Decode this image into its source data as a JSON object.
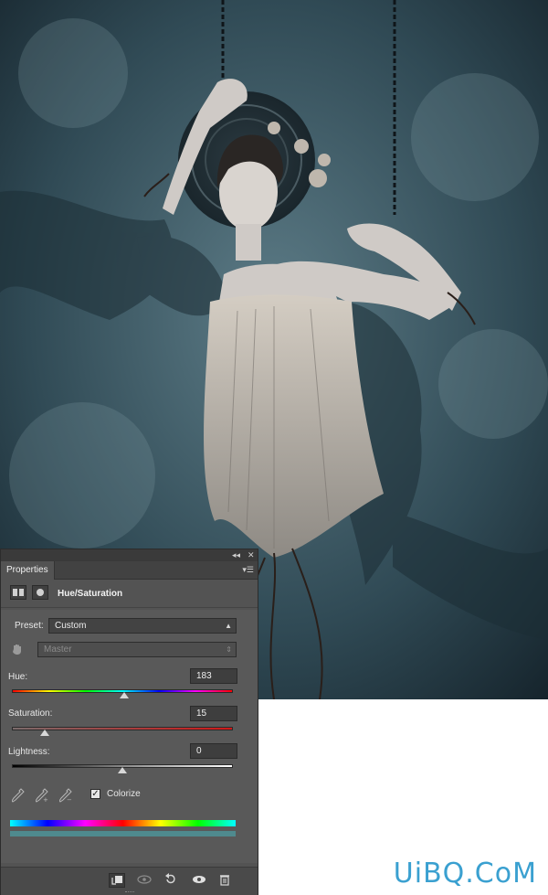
{
  "watermark": "UiBQ.CoM",
  "panel": {
    "tab_label": "Properties",
    "collapse_icon": "double-chevron-left-icon",
    "close_icon": "close-icon",
    "menu_icon": "panel-menu-icon",
    "adjustment_title": "Hue/Saturation",
    "preset": {
      "label": "Preset:",
      "value": "Custom"
    },
    "channel": {
      "value": "Master"
    },
    "hue": {
      "label": "Hue:",
      "value": "183",
      "slider_fraction": 0.508
    },
    "saturation": {
      "label": "Saturation:",
      "value": "15",
      "slider_fraction": 0.15
    },
    "lightness": {
      "label": "Lightness:",
      "value": "0",
      "slider_fraction": 0.5
    },
    "colorize": {
      "label": "Colorize",
      "checked": true,
      "mark": "✓"
    },
    "result_color": "#4f8a8e",
    "bottom_icons": [
      "clip-to-layer-icon",
      "view-previous-state-icon",
      "reset-icon",
      "visibility-eye-icon",
      "trash-icon"
    ]
  },
  "colors": {
    "panel_bg": "#535353",
    "accent": "#3aa0d0"
  }
}
